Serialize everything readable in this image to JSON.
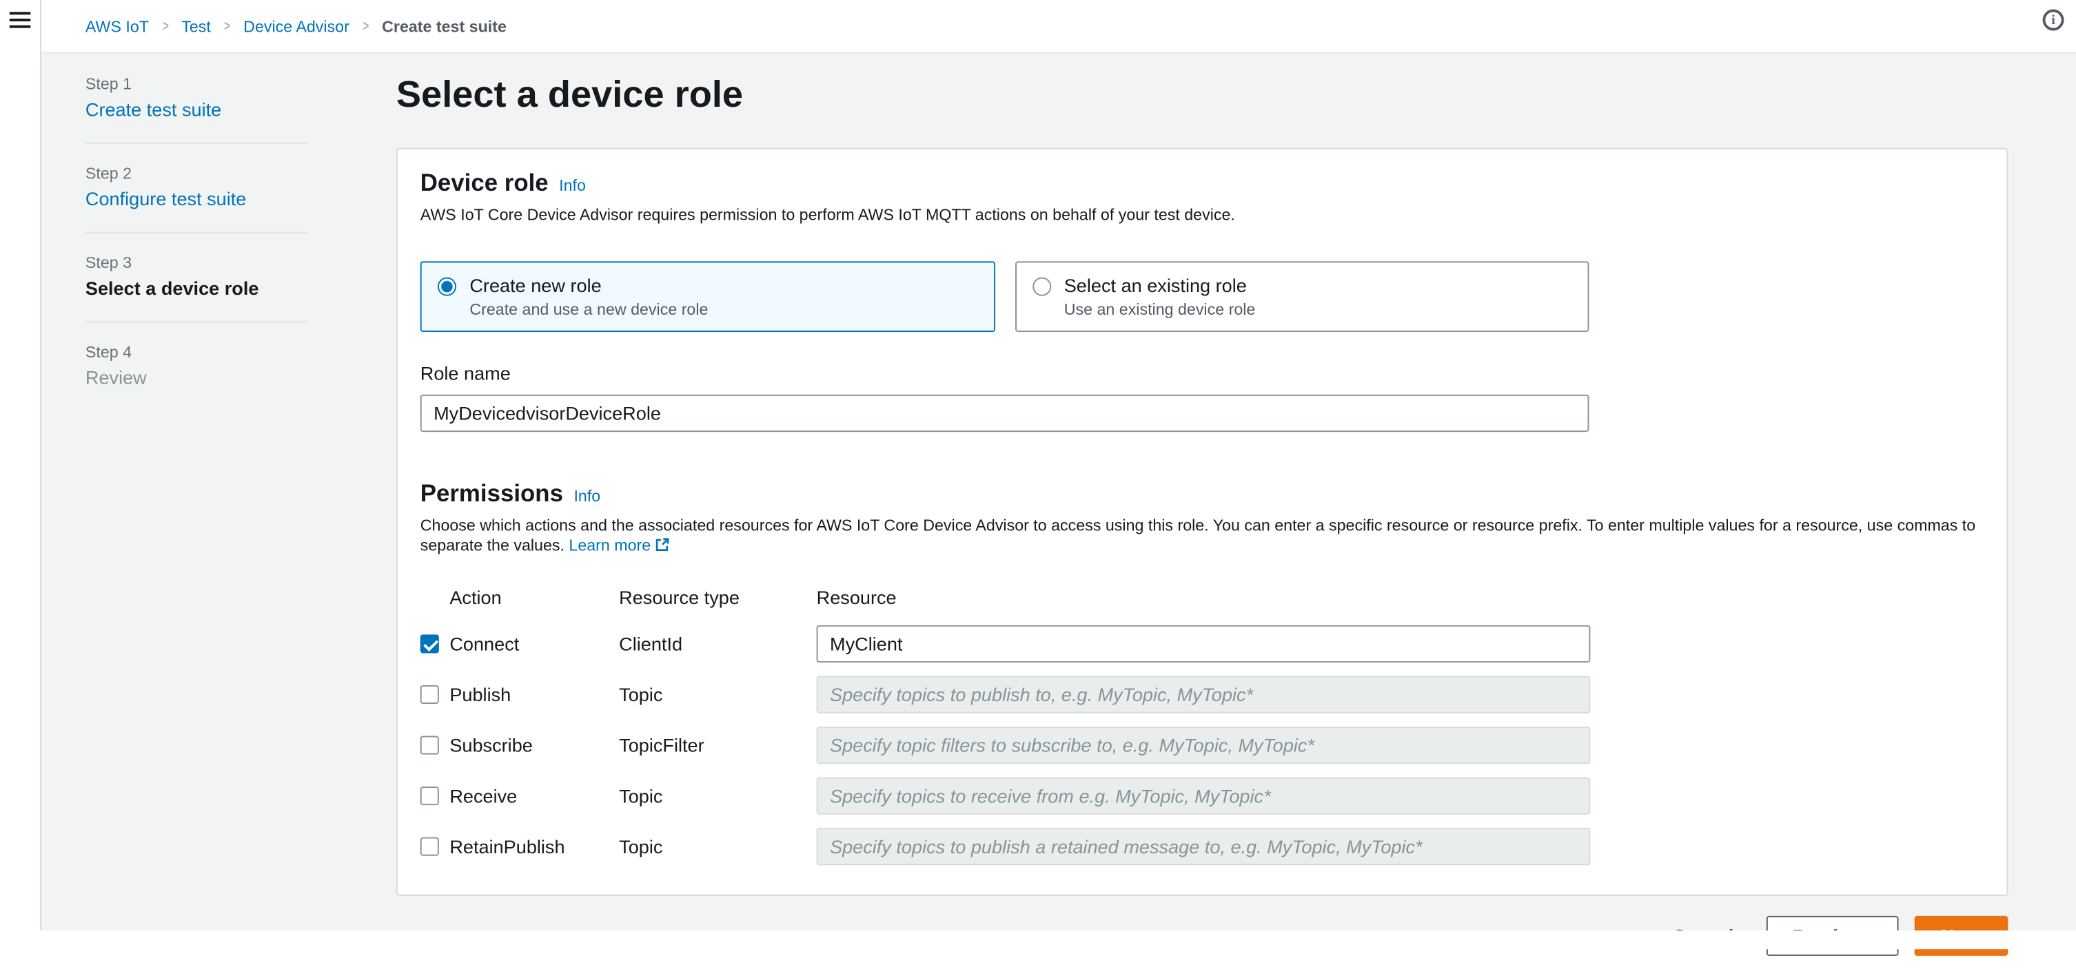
{
  "breadcrumb": {
    "items": [
      "AWS IoT",
      "Test",
      "Device Advisor",
      "Create test suite"
    ]
  },
  "steps": [
    {
      "step": "Step 1",
      "label": "Create test suite",
      "state": "link"
    },
    {
      "step": "Step 2",
      "label": "Configure test suite",
      "state": "link"
    },
    {
      "step": "Step 3",
      "label": "Select a device role",
      "state": "active"
    },
    {
      "step": "Step 4",
      "label": "Review",
      "state": "disabled"
    }
  ],
  "page": {
    "title": "Select a device role"
  },
  "device_role": {
    "title": "Device role",
    "info_label": "Info",
    "description": "AWS IoT Core Device Advisor requires permission to perform AWS IoT MQTT actions on behalf of your test device.",
    "options": [
      {
        "label": "Create new role",
        "sublabel": "Create and use a new device role",
        "selected": true
      },
      {
        "label": "Select an existing role",
        "sublabel": "Use an existing device role",
        "selected": false
      }
    ],
    "role_name_label": "Role name",
    "role_name_value": "MyDevicedvisorDeviceRole"
  },
  "permissions": {
    "title": "Permissions",
    "info_label": "Info",
    "description": "Choose which actions and the associated resources for AWS IoT Core Device Advisor to access using this role. You can enter a specific resource or resource prefix. To enter multiple values for a resource, use commas to separate the values.",
    "learn_more_label": "Learn more",
    "columns": [
      "Action",
      "Resource type",
      "Resource"
    ],
    "rows": [
      {
        "action": "Connect",
        "resource_type": "ClientId",
        "value": "MyClient",
        "placeholder": "",
        "checked": true,
        "enabled": true
      },
      {
        "action": "Publish",
        "resource_type": "Topic",
        "value": "",
        "placeholder": "Specify topics to publish to, e.g. MyTopic, MyTopic*",
        "checked": false,
        "enabled": false
      },
      {
        "action": "Subscribe",
        "resource_type": "TopicFilter",
        "value": "",
        "placeholder": "Specify topic filters to subscribe to, e.g. MyTopic, MyTopic*",
        "checked": false,
        "enabled": false
      },
      {
        "action": "Receive",
        "resource_type": "Topic",
        "value": "",
        "placeholder": "Specify topics to receive from e.g. MyTopic, MyTopic*",
        "checked": false,
        "enabled": false
      },
      {
        "action": "RetainPublish",
        "resource_type": "Topic",
        "value": "",
        "placeholder": "Specify topics to publish a retained message to, e.g. MyTopic, MyTopic*",
        "checked": false,
        "enabled": false
      }
    ]
  },
  "footer_buttons": {
    "cancel": "Cancel",
    "previous": "Previous",
    "next": "Next"
  },
  "icons": {
    "menu": "hamburger-icon",
    "help": "info-circle-icon",
    "breadcrumb_separator": "chevron-right-icon",
    "external_link": "external-link-icon"
  },
  "colors": {
    "link_blue": "#0073bb",
    "primary_orange": "#ec7211",
    "selected_tile_bg": "#f1faff",
    "content_bg": "#f2f3f3",
    "text_primary": "#16191f",
    "text_secondary": "#545b64",
    "disabled_input_bg": "#eaeded"
  }
}
